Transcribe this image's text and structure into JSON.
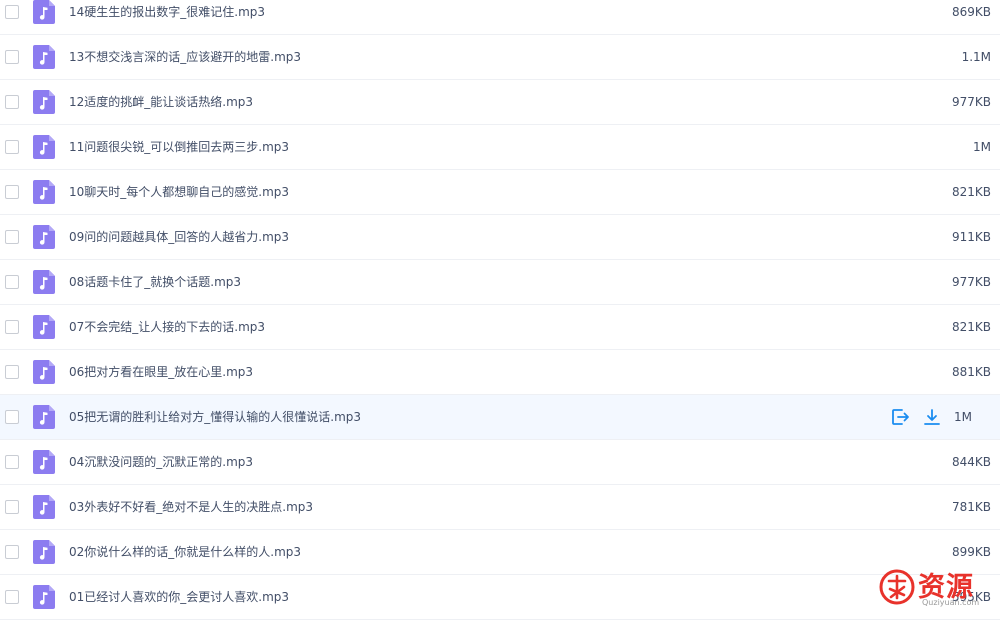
{
  "files": [
    {
      "name": "14硬生生的报出数字_很难记住.mp3",
      "size": "869KB"
    },
    {
      "name": "13不想交浅言深的话_应该避开的地雷.mp3",
      "size": "1.1M"
    },
    {
      "name": "12适度的挑衅_能让谈话热络.mp3",
      "size": "977KB"
    },
    {
      "name": "11问题很尖锐_可以倒推回去两三步.mp3",
      "size": "1M"
    },
    {
      "name": "10聊天时_每个人都想聊自己的感觉.mp3",
      "size": "821KB"
    },
    {
      "name": "09问的问题越具体_回答的人越省力.mp3",
      "size": "911KB"
    },
    {
      "name": "08话题卡住了_就换个话题.mp3",
      "size": "977KB"
    },
    {
      "name": "07不会完结_让人接的下去的话.mp3",
      "size": "821KB"
    },
    {
      "name": "06把对方看在眼里_放在心里.mp3",
      "size": "881KB"
    },
    {
      "name": "05把无谓的胜利让给对方_懂得认输的人很懂说话.mp3",
      "size": "1M"
    },
    {
      "name": "04沉默没问题的_沉默正常的.mp3",
      "size": "844KB"
    },
    {
      "name": "03外表好不好看_绝对不是人生的决胜点.mp3",
      "size": "781KB"
    },
    {
      "name": "02你说什么样的话_你就是什么样的人.mp3",
      "size": "899KB"
    },
    {
      "name": "01已经讨人喜欢的你_会更讨人喜欢.mp3",
      "size": "595KB"
    }
  ],
  "colors": {
    "file_icon": "#8c7cf0",
    "action_icon": "#1a8cf0",
    "hover_row": "#f3f8ff"
  },
  "watermark": {
    "text": "资源",
    "sub": "Quziyuan.com"
  }
}
